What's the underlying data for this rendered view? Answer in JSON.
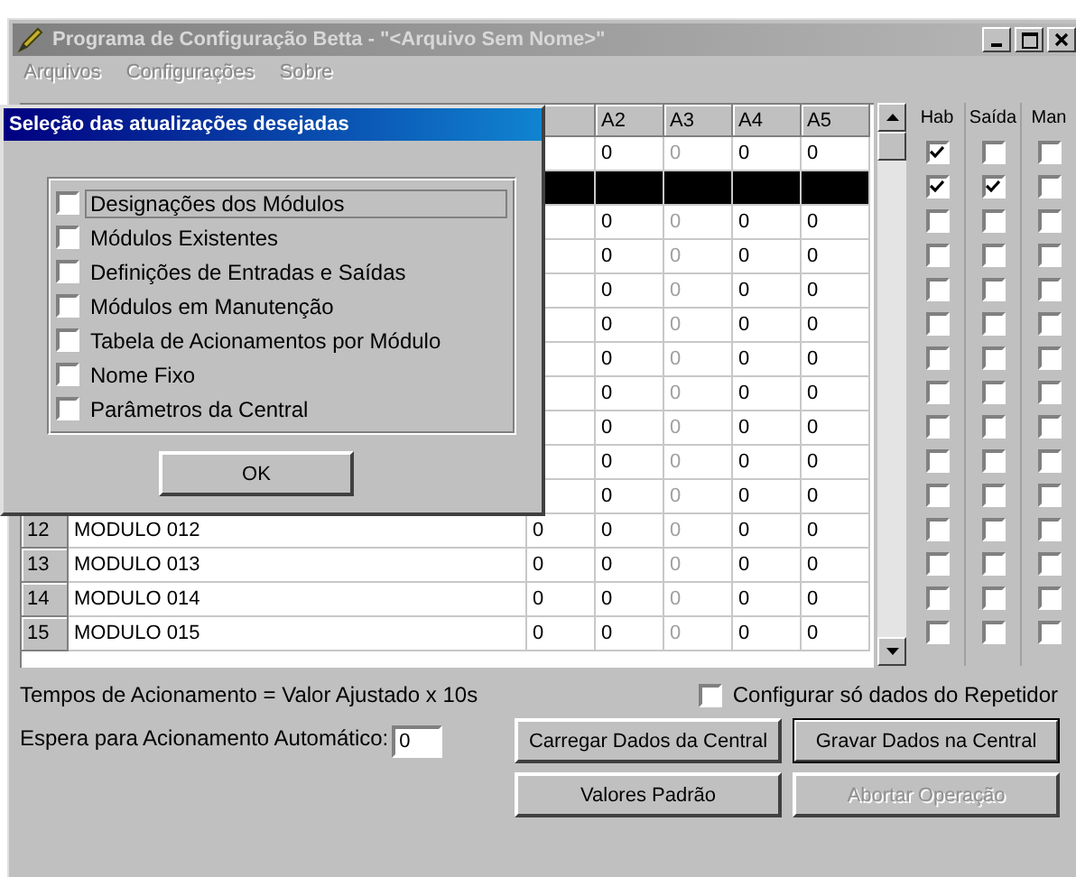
{
  "window": {
    "title": "Programa de Configuração Betta - \"<Arquivo Sem Nome>\""
  },
  "menu": [
    {
      "label": "Arquivos",
      "disabled": true
    },
    {
      "label": "Configurações",
      "disabled": true
    },
    {
      "label": "Sobre",
      "disabled": true
    }
  ],
  "table": {
    "columns": [
      {
        "label": "A2",
        "disabled": false
      },
      {
        "label": "A3",
        "disabled": true
      },
      {
        "label": "A4",
        "disabled": false
      },
      {
        "label": "A5",
        "disabled": false
      }
    ],
    "flag_columns": [
      "Hab",
      "Saída",
      "Man"
    ],
    "rows": [
      {
        "selected": false,
        "values": [
          "0",
          "0",
          "0",
          "0"
        ],
        "flags": {
          "hab": true,
          "saida": false,
          "man": false
        }
      },
      {
        "selected": true,
        "flags": {
          "hab": true,
          "saida": true,
          "man": false
        }
      },
      {
        "selected": false,
        "values": [
          "0",
          "0",
          "0",
          "0"
        ],
        "flags": {
          "hab": false,
          "saida": false,
          "man": false
        }
      },
      {
        "selected": false,
        "values": [
          "0",
          "0",
          "0",
          "0"
        ],
        "flags": {
          "hab": false,
          "saida": false,
          "man": false
        }
      },
      {
        "selected": false,
        "values": [
          "0",
          "0",
          "0",
          "0"
        ],
        "flags": {
          "hab": false,
          "saida": false,
          "man": false
        }
      },
      {
        "selected": false,
        "values": [
          "0",
          "0",
          "0",
          "0"
        ],
        "flags": {
          "hab": false,
          "saida": false,
          "man": false
        }
      },
      {
        "selected": false,
        "values": [
          "0",
          "0",
          "0",
          "0"
        ],
        "flags": {
          "hab": false,
          "saida": false,
          "man": false
        }
      },
      {
        "selected": false,
        "values": [
          "0",
          "0",
          "0",
          "0"
        ],
        "flags": {
          "hab": false,
          "saida": false,
          "man": false
        }
      },
      {
        "selected": false,
        "values": [
          "0",
          "0",
          "0",
          "0"
        ],
        "flags": {
          "hab": false,
          "saida": false,
          "man": false
        }
      },
      {
        "selected": false,
        "values": [
          "0",
          "0",
          "0",
          "0"
        ],
        "flags": {
          "hab": false,
          "saida": false,
          "man": false
        }
      },
      {
        "selected": false,
        "values": [
          "0",
          "0",
          "0",
          "0"
        ],
        "flags": {
          "hab": false,
          "saida": false,
          "man": false
        }
      },
      {
        "selected": false,
        "number": "12",
        "name": "MODULO 012",
        "a1": "0",
        "values": [
          "0",
          "0",
          "0",
          "0"
        ],
        "flags": {
          "hab": false,
          "saida": false,
          "man": false
        }
      },
      {
        "selected": false,
        "number": "13",
        "name": "MODULO 013",
        "a1": "0",
        "values": [
          "0",
          "0",
          "0",
          "0"
        ],
        "flags": {
          "hab": false,
          "saida": false,
          "man": false
        }
      },
      {
        "selected": false,
        "number": "14",
        "name": "MODULO 014",
        "a1": "0",
        "values": [
          "0",
          "0",
          "0",
          "0"
        ],
        "flags": {
          "hab": false,
          "saida": false,
          "man": false
        }
      },
      {
        "selected": false,
        "number": "15",
        "name": "MODULO 015",
        "a1": "0",
        "values": [
          "0",
          "0",
          "0",
          "0"
        ],
        "flags": {
          "hab": false,
          "saida": false,
          "man": false
        }
      }
    ]
  },
  "note": "Tempos de Acionamento = Valor Ajustado x 10s",
  "repeater_option": {
    "label": "Configurar só dados do Repetidor",
    "checked": false
  },
  "auto_wait": {
    "label": "Espera para Acionamento Automático:",
    "value": "0"
  },
  "buttons": [
    {
      "label": "Carregar Dados da Central",
      "disabled": false,
      "default": false
    },
    {
      "label": "Gravar Dados na Central",
      "disabled": false,
      "default": true
    },
    {
      "label": "Valores Padrão",
      "disabled": false,
      "default": false
    },
    {
      "label": "Abortar Operação",
      "disabled": true,
      "default": false
    }
  ],
  "dialog": {
    "title": "Seleção das atualizações desejadas",
    "options": [
      {
        "label": "Designações dos Módulos",
        "checked": false,
        "focused": true
      },
      {
        "label": "Módulos Existentes",
        "checked": false,
        "focused": false
      },
      {
        "label": "Definições de Entradas e Saídas",
        "checked": false,
        "focused": false
      },
      {
        "label": "Módulos em Manutenção",
        "checked": false,
        "focused": false
      },
      {
        "label": "Tabela de Acionamentos por Módulo",
        "checked": false,
        "focused": false
      },
      {
        "label": "Nome Fixo",
        "checked": false,
        "focused": false
      },
      {
        "label": "Parâmetros da Central",
        "checked": false,
        "focused": false
      }
    ],
    "ok": "OK"
  }
}
